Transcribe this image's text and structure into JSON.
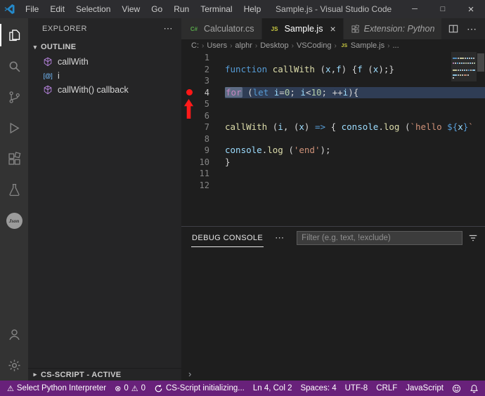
{
  "titlebar": {
    "menus": [
      "File",
      "Edit",
      "Selection",
      "View",
      "Go",
      "Run",
      "Terminal",
      "Help"
    ],
    "title": "Sample.js - Visual Studio Code",
    "controls": {
      "minimize": "─",
      "maximize": "□",
      "close": "×"
    }
  },
  "activity_bar": {
    "top": [
      {
        "name": "explorer",
        "active": true
      },
      {
        "name": "search",
        "active": false
      },
      {
        "name": "source-control",
        "active": false
      },
      {
        "name": "run-debug",
        "active": false
      },
      {
        "name": "extensions",
        "active": false
      },
      {
        "name": "test-beaker",
        "active": false
      },
      {
        "name": "json-badge",
        "active": false,
        "label": "Json"
      }
    ],
    "bottom": [
      {
        "name": "account"
      },
      {
        "name": "settings"
      }
    ]
  },
  "sidebar": {
    "title": "EXPLORER",
    "outline": {
      "label": "OUTLINE",
      "items": [
        {
          "label": "callWith",
          "icon": "symbol-method"
        },
        {
          "label": "i",
          "icon": "symbol-variable"
        },
        {
          "label": "callWith() callback",
          "icon": "symbol-method"
        }
      ]
    },
    "bottom_section": {
      "label": "CS-SCRIPT - ACTIVE"
    }
  },
  "editor": {
    "file_icons": {
      "js": "JS",
      "csharp": "C#"
    },
    "tabs": [
      {
        "label": "Calculator.cs",
        "icon": "csharp",
        "active": false,
        "italic": false
      },
      {
        "label": "Sample.js",
        "icon": "js",
        "active": true,
        "italic": false,
        "close": "×"
      },
      {
        "label": "Extension: Python",
        "icon": "extension",
        "active": false,
        "italic": true
      }
    ],
    "breadcrumb": {
      "separator": "›",
      "items": [
        {
          "label": "C:"
        },
        {
          "label": "Users"
        },
        {
          "label": "alphr"
        },
        {
          "label": "Desktop"
        },
        {
          "label": "VSCoding"
        },
        {
          "label": "Sample.js",
          "icon": "js"
        },
        {
          "label": "..."
        }
      ]
    },
    "code": {
      "active_line": 4,
      "breakpoint_line": 4,
      "lines": [
        {
          "num": "1",
          "tokens": []
        },
        {
          "num": "2",
          "tokens": [
            {
              "t": "function",
              "c": "kw"
            },
            {
              "t": " ",
              "c": "pln"
            },
            {
              "t": "callWith",
              "c": "fn"
            },
            {
              "t": " (",
              "c": "pln"
            },
            {
              "t": "x",
              "c": "vr"
            },
            {
              "t": ",",
              "c": "pln"
            },
            {
              "t": "f",
              "c": "vr"
            },
            {
              "t": ") {",
              "c": "pln"
            },
            {
              "t": "f",
              "c": "vr"
            },
            {
              "t": " (",
              "c": "pln"
            },
            {
              "t": "x",
              "c": "vr"
            },
            {
              "t": ");}",
              "c": "pln"
            }
          ]
        },
        {
          "num": "3",
          "tokens": []
        },
        {
          "num": "4",
          "tokens": [
            {
              "t": "for",
              "c": "ctrl",
              "hl": true
            },
            {
              "t": " (",
              "c": "pln"
            },
            {
              "t": "let",
              "c": "kw"
            },
            {
              "t": " ",
              "c": "pln"
            },
            {
              "t": "i",
              "c": "vr"
            },
            {
              "t": "=",
              "c": "pln"
            },
            {
              "t": "0",
              "c": "num"
            },
            {
              "t": "; ",
              "c": "pln"
            },
            {
              "t": "i",
              "c": "vr"
            },
            {
              "t": "<",
              "c": "pln"
            },
            {
              "t": "10",
              "c": "num"
            },
            {
              "t": "; ",
              "c": "pln"
            },
            {
              "t": "++",
              "c": "pln"
            },
            {
              "t": "i",
              "c": "vr"
            },
            {
              "t": "){",
              "c": "pln"
            }
          ]
        },
        {
          "num": "5",
          "tokens": []
        },
        {
          "num": "6",
          "tokens": []
        },
        {
          "num": "7",
          "tokens": [
            {
              "t": "callWith",
              "c": "fn"
            },
            {
              "t": " (",
              "c": "pln"
            },
            {
              "t": "i",
              "c": "vr"
            },
            {
              "t": ", (",
              "c": "pln"
            },
            {
              "t": "x",
              "c": "vr"
            },
            {
              "t": ") ",
              "c": "pln"
            },
            {
              "t": "=>",
              "c": "kw"
            },
            {
              "t": " { ",
              "c": "pln"
            },
            {
              "t": "console",
              "c": "vr"
            },
            {
              "t": ".",
              "c": "pln"
            },
            {
              "t": "log",
              "c": "fn"
            },
            {
              "t": " (",
              "c": "pln"
            },
            {
              "t": "`hello ",
              "c": "str"
            },
            {
              "t": "${",
              "c": "kw"
            },
            {
              "t": "x",
              "c": "vr"
            },
            {
              "t": "}",
              "c": "kw"
            },
            {
              "t": "`",
              "c": "str"
            }
          ]
        },
        {
          "num": "8",
          "tokens": []
        },
        {
          "num": "9",
          "tokens": [
            {
              "t": "console",
              "c": "vr"
            },
            {
              "t": ".",
              "c": "pln"
            },
            {
              "t": "log",
              "c": "fn"
            },
            {
              "t": " (",
              "c": "pln"
            },
            {
              "t": "'end'",
              "c": "str"
            },
            {
              "t": ");",
              "c": "pln"
            }
          ]
        },
        {
          "num": "10",
          "tokens": [
            {
              "t": "}",
              "c": "pln"
            }
          ]
        },
        {
          "num": "11",
          "tokens": []
        },
        {
          "num": "12",
          "tokens": []
        }
      ]
    }
  },
  "panel": {
    "tab": "DEBUG CONSOLE",
    "filter_placeholder": "Filter (e.g. text, !exclude)",
    "prompt": "›"
  },
  "statusbar": {
    "colors": {
      "background": "#68217a"
    },
    "left": [
      {
        "name": "python-interpreter",
        "icon": "warning",
        "label": "Select Python Interpreter"
      },
      {
        "name": "problems",
        "icon": "error",
        "label": "0",
        "icon2": "warning",
        "label2": "0"
      },
      {
        "name": "cs-script",
        "icon": "sync",
        "label": "CS-Script initializing..."
      }
    ],
    "right": [
      {
        "name": "cursor-position",
        "label": "Ln 4, Col 2"
      },
      {
        "name": "indentation",
        "label": "Spaces: 4"
      },
      {
        "name": "encoding",
        "label": "UTF-8"
      },
      {
        "name": "eol",
        "label": "CRLF"
      },
      {
        "name": "language-mode",
        "label": "JavaScript"
      },
      {
        "name": "feedback",
        "icon": "feedback"
      },
      {
        "name": "notifications",
        "icon": "bell"
      }
    ]
  }
}
